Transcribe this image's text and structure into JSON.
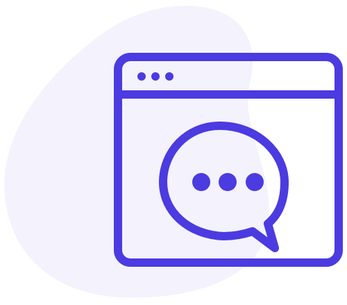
{
  "illustration": {
    "icon": "browser-window-chat-icon",
    "colors": {
      "stroke": "#4B3BE0",
      "blob": "#F3F2FD",
      "background": "#FFFFFF"
    },
    "window_controls_count": 3,
    "typing_dots_count": 3
  }
}
